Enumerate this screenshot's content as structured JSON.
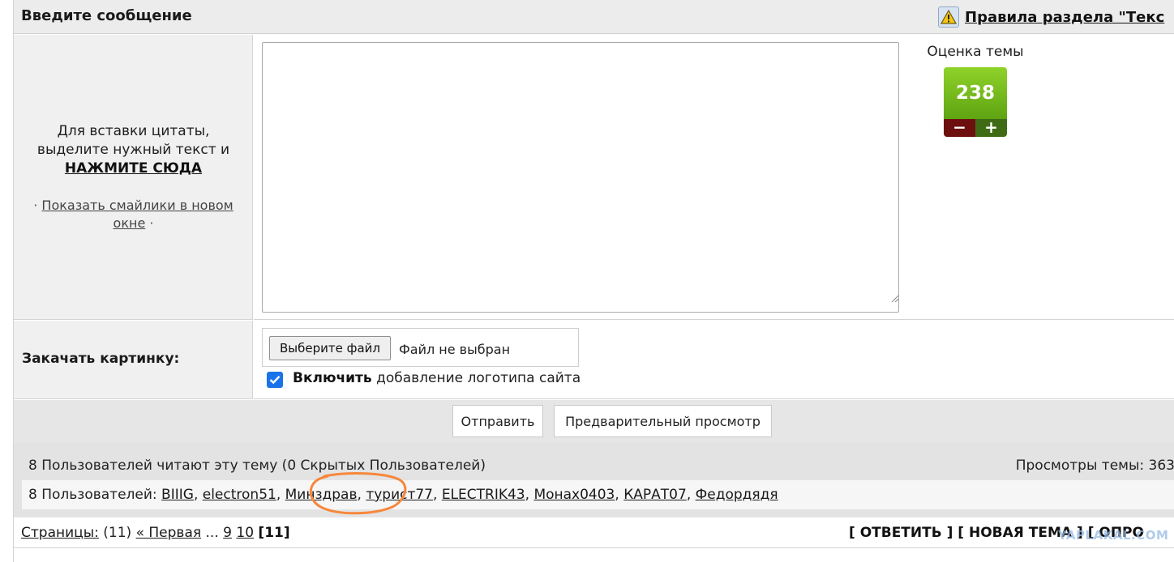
{
  "header": {
    "title": "Введите сообщение",
    "rules_link": "Правила раздела \"Текс"
  },
  "left_panel": {
    "quote_line1": "Для вставки цитаты,",
    "quote_line2": "выделите нужный текст и",
    "quote_link": "НАЖМИТЕ СЮДА",
    "smiles_link": "Показать смайлики в новом окне"
  },
  "message": {
    "value": ""
  },
  "rating": {
    "title": "Оценка темы",
    "score": "238",
    "minus": "−",
    "plus": "+"
  },
  "upload": {
    "label": "Закачать картинку:",
    "choose_file": "Выберите файл",
    "file_status": "Файл не выбран",
    "logo_bold": "Включить",
    "logo_rest": " добавление логотипа сайта",
    "logo_checked": true
  },
  "buttons": {
    "send": "Отправить",
    "preview": "Предварительный просмотр"
  },
  "readers": {
    "summary": "8 Пользователей читают эту тему (0 Скрытых Пользователей)",
    "views": "Просмотры темы: 363",
    "users_prefix": "8 Пользователей: ",
    "users": [
      "BIIIG",
      "electron51",
      "Минздрав",
      "турист77",
      "ELECTRIK43",
      "Монах0403",
      "КАРАТ07",
      "Федордядя"
    ]
  },
  "pagination": {
    "label": "Страницы:",
    "count": "(11)",
    "first": "« Первая",
    "ellipsis": "...",
    "pages": [
      "9",
      "10"
    ],
    "current": "[11]"
  },
  "actions": {
    "reply": "[ ОТВЕТИТЬ ]",
    "new_topic": "[ НОВАЯ ТЕМА ]",
    "poll": "[ ОПРО"
  },
  "watermark": "YAPLAKAL.COM",
  "colors": {
    "rating_green": "#5fa412",
    "minus_red": "#6e0f0f",
    "plus_green": "#3f6b14",
    "checkbox_blue": "#1a73e8",
    "highlight_orange": "#f7873b"
  },
  "icons": [
    "warning-icon",
    "checkmark-icon",
    "resize-grip-icon"
  ]
}
